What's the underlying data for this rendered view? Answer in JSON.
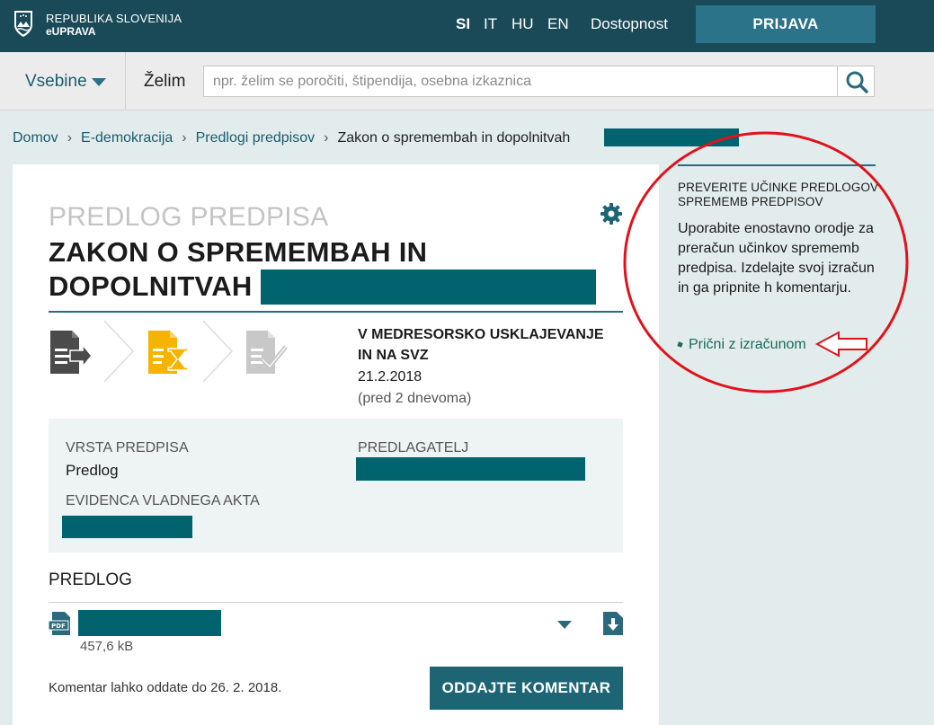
{
  "header": {
    "brand_line1": "REPUBLIKA SLOVENIJA",
    "brand_line2": "eUPRAVA",
    "languages": [
      "SI",
      "IT",
      "HU",
      "EN"
    ],
    "active_language": "SI",
    "accessibility_label": "Dostopnost",
    "login_label": "PRIJAVA"
  },
  "search": {
    "menu_label": "Vsebine",
    "want_label": "Želim",
    "placeholder": "npr. želim se poročiti, štipendija, osebna izkaznica"
  },
  "breadcrumb": {
    "items": [
      "Domov",
      "E-demokracija",
      "Predlogi predpisov"
    ],
    "current": "Zakon o spremembah in dopolnitvah"
  },
  "document": {
    "kicker": "PREDLOG PREDPISA",
    "title_line1": "ZAKON O SPREMEMBAH IN",
    "title_line2": "DOPOLNITVAH",
    "status_title": "V MEDRESORSKO USKLAJEVANJE IN NA SVZ",
    "status_date": "21.2.2018",
    "status_relative": "(pred 2 dnevoma)",
    "meta": {
      "type_label": "VRSTA PREDPISA",
      "type_value": "Predlog",
      "proposer_label": "PREDLAGATELJ",
      "record_label": "EVIDENCA VLADNEGA AKTA"
    },
    "section_title": "PREDLOG",
    "file_size": "457,6 kB",
    "deadline_text": "Komentar lahko oddate do 26. 2. 2018.",
    "comment_button": "ODDAJTE KOMENTAR"
  },
  "sidebar": {
    "title": "PREVERITE UČINKE PREDLOGOV SPREMEMB PREDPISOV",
    "text": "Uporabite enostavno orodje za preračun učinkov sprememb predpisa. Izdelajte svoj izračun in ga pripnite h komentarju.",
    "link_label": "Prični z izračunom"
  },
  "colors": {
    "header_bg": "#1a4a57",
    "accent": "#2b7388",
    "redaction": "#00636e",
    "annotation": "#e0121b",
    "step_active": "#f5b400"
  }
}
